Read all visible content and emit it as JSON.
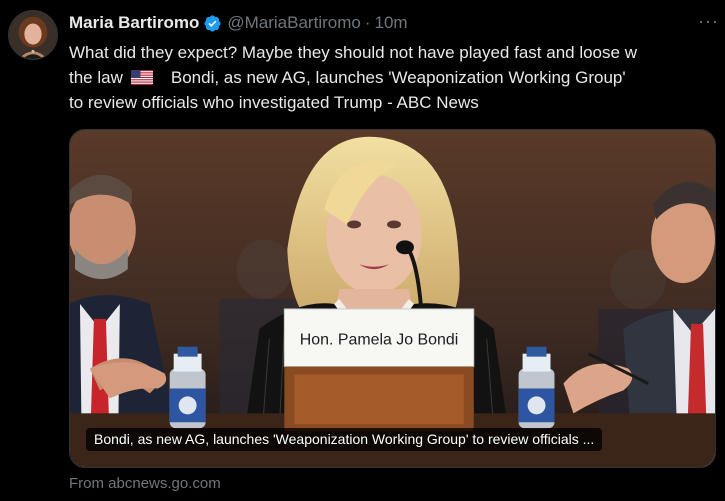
{
  "author": {
    "display_name": "Maria Bartiromo",
    "handle": "@MariaBartiromo",
    "separator": "·",
    "timestamp": "10m",
    "avatar_icon": "profile-photo-avatar",
    "verified_icon": "verified-badge-icon",
    "verified_color": "#1d9bf0"
  },
  "more_label": "···",
  "tweet": {
    "line1": "What did they expect? Maybe they should not have played fast and loose w",
    "line2_pre": "the law",
    "flag_icon": "us-flag-emoji-icon",
    "line2_post": "Bondi, as new AG, launches 'Weaponization Working Group'",
    "line3": "to review officials who investigated Trump - ABC News"
  },
  "card": {
    "image_icon": "photo-pam-bondi-at-hearing",
    "nameplate": "Hon. Pamela Jo Bondi",
    "caption": "Bondi, as new AG, launches 'Weaponization Working Group' to review officials ...",
    "source": "From abcnews.go.com"
  },
  "colors": {
    "background": "#000000",
    "text_primary": "#e7e9ea",
    "text_secondary": "#71767b",
    "border": "#2f3336"
  }
}
